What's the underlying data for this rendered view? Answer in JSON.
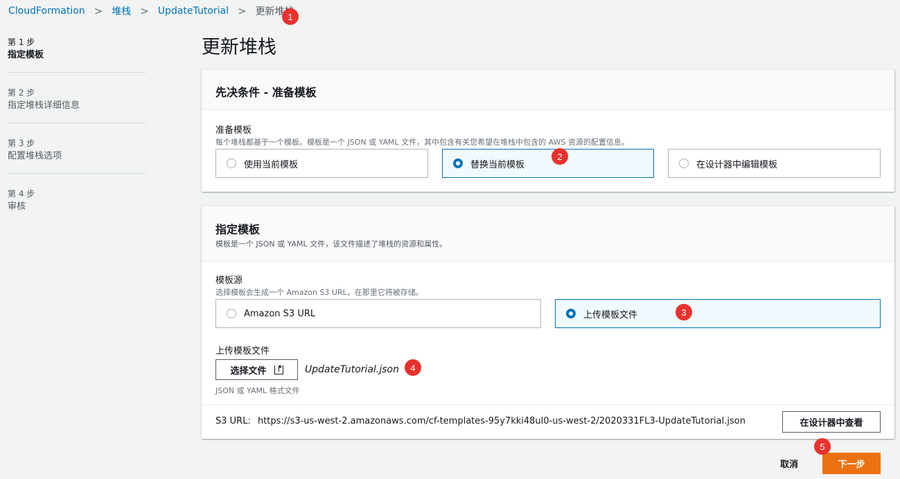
{
  "breadcrumb": {
    "items": [
      "CloudFormation",
      "堆栈",
      "UpdateTutorial"
    ],
    "current": "更新堆栈"
  },
  "badges": [
    "1",
    "2",
    "3",
    "4",
    "5"
  ],
  "sidebar": {
    "steps": [
      {
        "num": "第 1 步",
        "name": "指定模板"
      },
      {
        "num": "第 2 步",
        "name": "指定堆栈详细信息"
      },
      {
        "num": "第 3 步",
        "name": "配置堆栈选项"
      },
      {
        "num": "第 4 步",
        "name": "审核"
      }
    ]
  },
  "page_title": "更新堆栈",
  "prereq": {
    "title": "先决条件 - 准备模板",
    "label": "准备模板",
    "description": "每个堆栈都基于一个模板。模板是一个 JSON 或 YAML 文件，其中包含有关您希望在堆栈中包含的 AWS 资源的配置信息。",
    "options": [
      "使用当前模板",
      "替换当前模板",
      "在设计器中编辑模板"
    ],
    "selected_index": 1
  },
  "template": {
    "title": "指定模板",
    "description": "模板是一个 JSON 或 YAML 文件，该文件描述了堆栈的资源和属性。",
    "source_label": "模板源",
    "source_description": "选择模板会生成一个 Amazon S3 URL，在那里它将被存储。",
    "source_options": [
      "Amazon S3 URL",
      "上传模板文件"
    ],
    "source_selected_index": 1,
    "upload_label": "上传模板文件",
    "choose_file_button": "选择文件",
    "file_name": "UpdateTutorial.json",
    "upload_hint": "JSON 或 YAML 格式文件",
    "s3_url_label": "S3 URL:",
    "s3_url": "https://s3-us-west-2.amazonaws.com/cf-templates-95y7kki48ul0-us-west-2/2020331FL3-UpdateTutorial.json",
    "view_in_designer_button": "在设计器中查看"
  },
  "footer": {
    "cancel": "取消",
    "next": "下一步"
  },
  "colors": {
    "accent": "#0073bb",
    "primary_button": "#ec7211",
    "badge": "#e8322e"
  }
}
